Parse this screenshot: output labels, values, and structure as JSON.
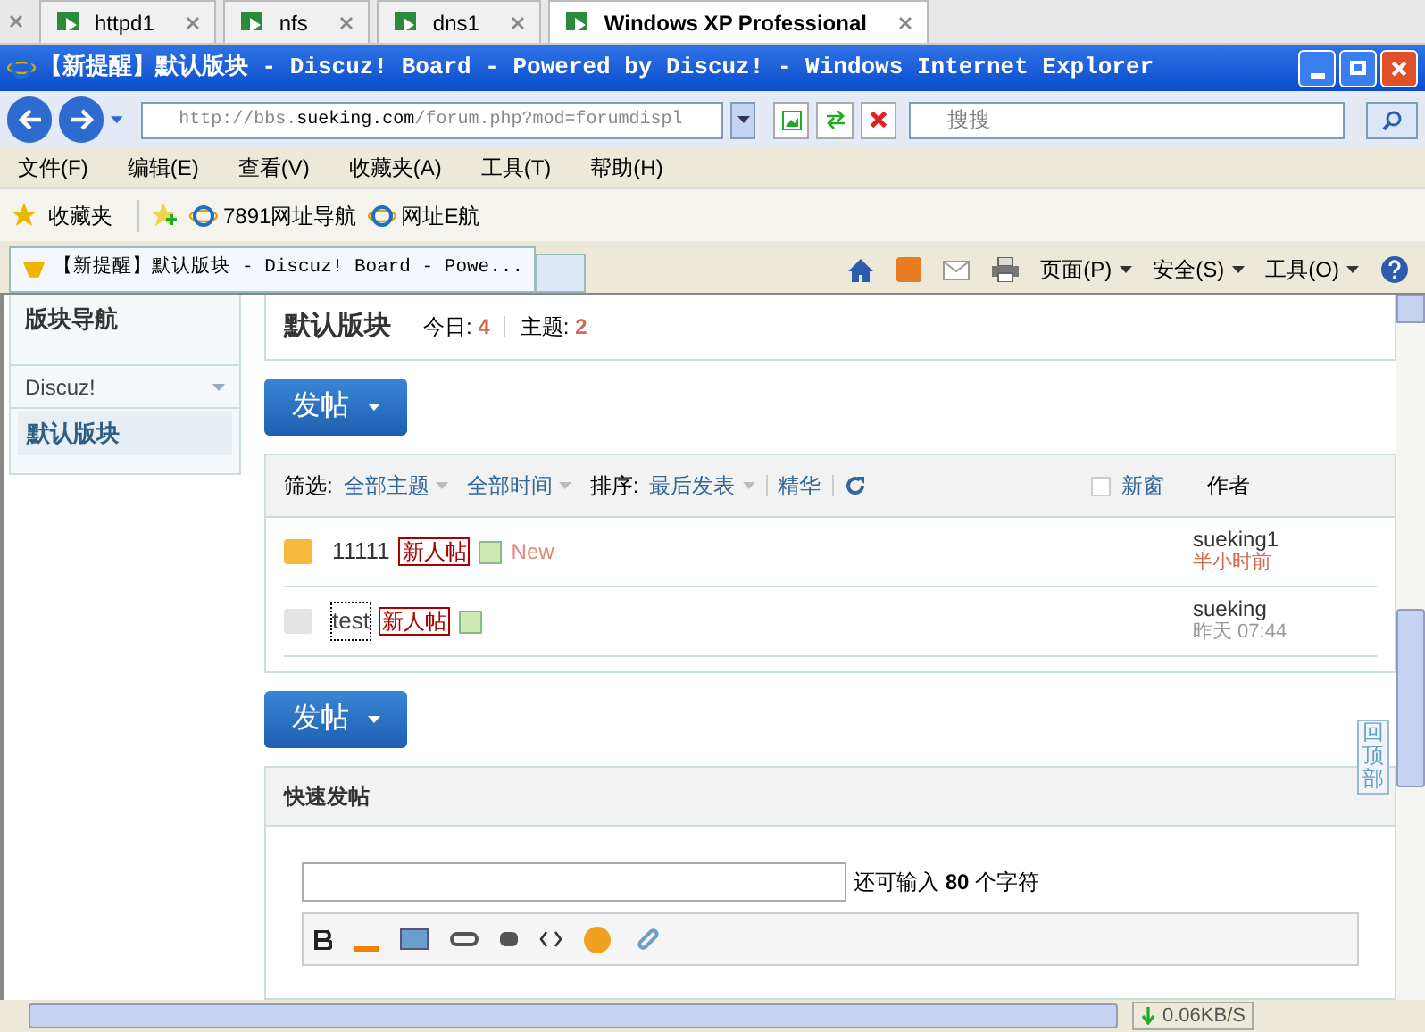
{
  "vm_tabs": [
    {
      "label": "httpd1",
      "selected": false
    },
    {
      "label": "nfs",
      "selected": false
    },
    {
      "label": "dns1",
      "selected": false
    },
    {
      "label": "Windows XP Professional",
      "selected": true
    }
  ],
  "window": {
    "title": "【新提醒】默认版块 - Discuz! Board - Powered by Discuz! - Windows Internet Explorer"
  },
  "address": {
    "prefix": "http://bbs.",
    "domain": "sueking.com",
    "rest": "/forum.php?mod=forumdispl"
  },
  "search": {
    "placeholder": "搜搜"
  },
  "menu": [
    "文件(F)",
    "编辑(E)",
    "查看(V)",
    "收藏夹(A)",
    "工具(T)",
    "帮助(H)"
  ],
  "favorites": {
    "label": "收藏夹",
    "links": [
      "7891网址导航",
      "网址E航"
    ]
  },
  "browser_tab": {
    "label": "【新提醒】默认版块 - Discuz! Board - Powe..."
  },
  "command_bar": [
    "页面(P)",
    "安全(S)",
    "工具(O)"
  ],
  "sidebar": {
    "title": "版块导航",
    "group": "Discuz!",
    "items": [
      {
        "label": "默认版块",
        "selected": true
      }
    ]
  },
  "forum": {
    "title": "默认版块",
    "today_label": "今日:",
    "today": "4",
    "topics_label": "主题:",
    "topics": "2"
  },
  "post_buttons": [
    "发帖",
    "发帖"
  ],
  "filters": {
    "label": "筛选:",
    "options": [
      "全部主题",
      "全部时间"
    ],
    "sort_label": "排序:",
    "sort": "最后发表",
    "digest": "精华",
    "new_window": {
      "label": "新窗",
      "checked": false
    },
    "author": "作者"
  },
  "threads": [
    {
      "title": "11111",
      "tag": "新人帖",
      "new": "New",
      "unread": true,
      "author": "sueking1",
      "time": "半小时前",
      "recent": true
    },
    {
      "title": "test",
      "tag": "新人帖",
      "unread": false,
      "author": "sueking",
      "time": "昨天 07:44",
      "recent": false
    }
  ],
  "back_to_top": "回顶部",
  "quick_post": {
    "title": "快速发帖",
    "counter": "还可输入 **80** 个字符"
  },
  "status": {
    "down": "0.06KB/S"
  }
}
